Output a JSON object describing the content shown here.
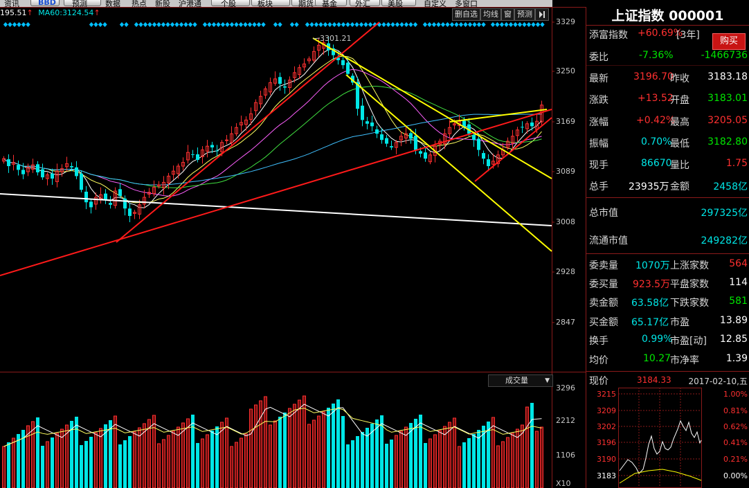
{
  "topbar": {
    "items": [
      "资讯",
      "BBD",
      "预测",
      "数据",
      "热点",
      "新股",
      "沪港通",
      "个股",
      "板块",
      "期货",
      "基金",
      "外汇",
      "美股",
      "自定义",
      "多窗口"
    ]
  },
  "ma_row": {
    "ma_left_value": "195.51",
    "ma60_label": "MA60:",
    "ma60_value": "3124.54",
    "arrow": "↑"
  },
  "toolbar": {
    "buttons": [
      "删自选",
      "均线",
      "窗",
      "预测"
    ],
    "collapse_icon": "collapse-right-icon"
  },
  "price_axis": [
    "3329",
    "3250",
    "3169",
    "3089",
    "3008",
    "2928",
    "2847"
  ],
  "peak_label": "3301.21",
  "volume": {
    "title": "成交量",
    "axis": [
      "3296",
      "2212",
      "1106",
      "X10"
    ]
  },
  "colors": {
    "up": "#ff3030",
    "down": "#00e6e6",
    "bg": "#000000",
    "grid": "#8b1a1a"
  },
  "info": {
    "title": "上证指数 000001",
    "rows": [
      {
        "label": "添富指数",
        "value": "+60.69%",
        "extra": "[3年]"
      },
      {
        "label": "委比",
        "value": "-7.36%",
        "value2": "-1466736"
      },
      {
        "label": "最新",
        "value": "3196.70",
        "label2": "昨收",
        "value2": "3183.18"
      },
      {
        "label": "涨跌",
        "value": "+13.52",
        "label2": "开盘",
        "value2": "3183.01"
      },
      {
        "label": "涨幅",
        "value": "+0.42%",
        "label2": "最高",
        "value2": "3205.05"
      },
      {
        "label": "振幅",
        "value": "0.70%",
        "label2": "最低",
        "value2": "3182.80"
      },
      {
        "label": "现手",
        "value": "86670",
        "label2": "量比",
        "value2": "1.75"
      },
      {
        "label": "总手",
        "value": "23935万",
        "label2": "金额",
        "value2": "2458亿"
      }
    ],
    "buy_button": "购买",
    "market": [
      {
        "label": "总市值",
        "value": "297325亿"
      },
      {
        "label": "流通市值",
        "value": "249282亿"
      }
    ],
    "stats": [
      {
        "label": "委卖量",
        "value": "1070万",
        "label2": "上涨家数",
        "value2": "564"
      },
      {
        "label": "委买量",
        "value": "923.5万",
        "label2": "平盘家数",
        "value2": "114"
      },
      {
        "label": "卖金额",
        "value": "63.58亿",
        "label2": "下跌家数",
        "value2": "581"
      },
      {
        "label": "买金额",
        "value": "65.17亿",
        "label2": "市盈",
        "value2": "13.89"
      },
      {
        "label": "换手",
        "value": "0.99%",
        "label2": "市盈[动]",
        "value2": "12.85"
      },
      {
        "label": "均价",
        "value": "10.27",
        "label2": "市净率",
        "value2": "1.39"
      }
    ],
    "mini": {
      "label": "现价",
      "price": "3184.33",
      "date": "2017-02-10,五",
      "left_axis": [
        "3215",
        "3209",
        "3202",
        "3196",
        "3190",
        "3183"
      ],
      "right_axis": [
        "1.00%",
        "0.81%",
        "0.62%",
        "0.41%",
        "0.21%",
        "0.00%"
      ]
    }
  }
}
